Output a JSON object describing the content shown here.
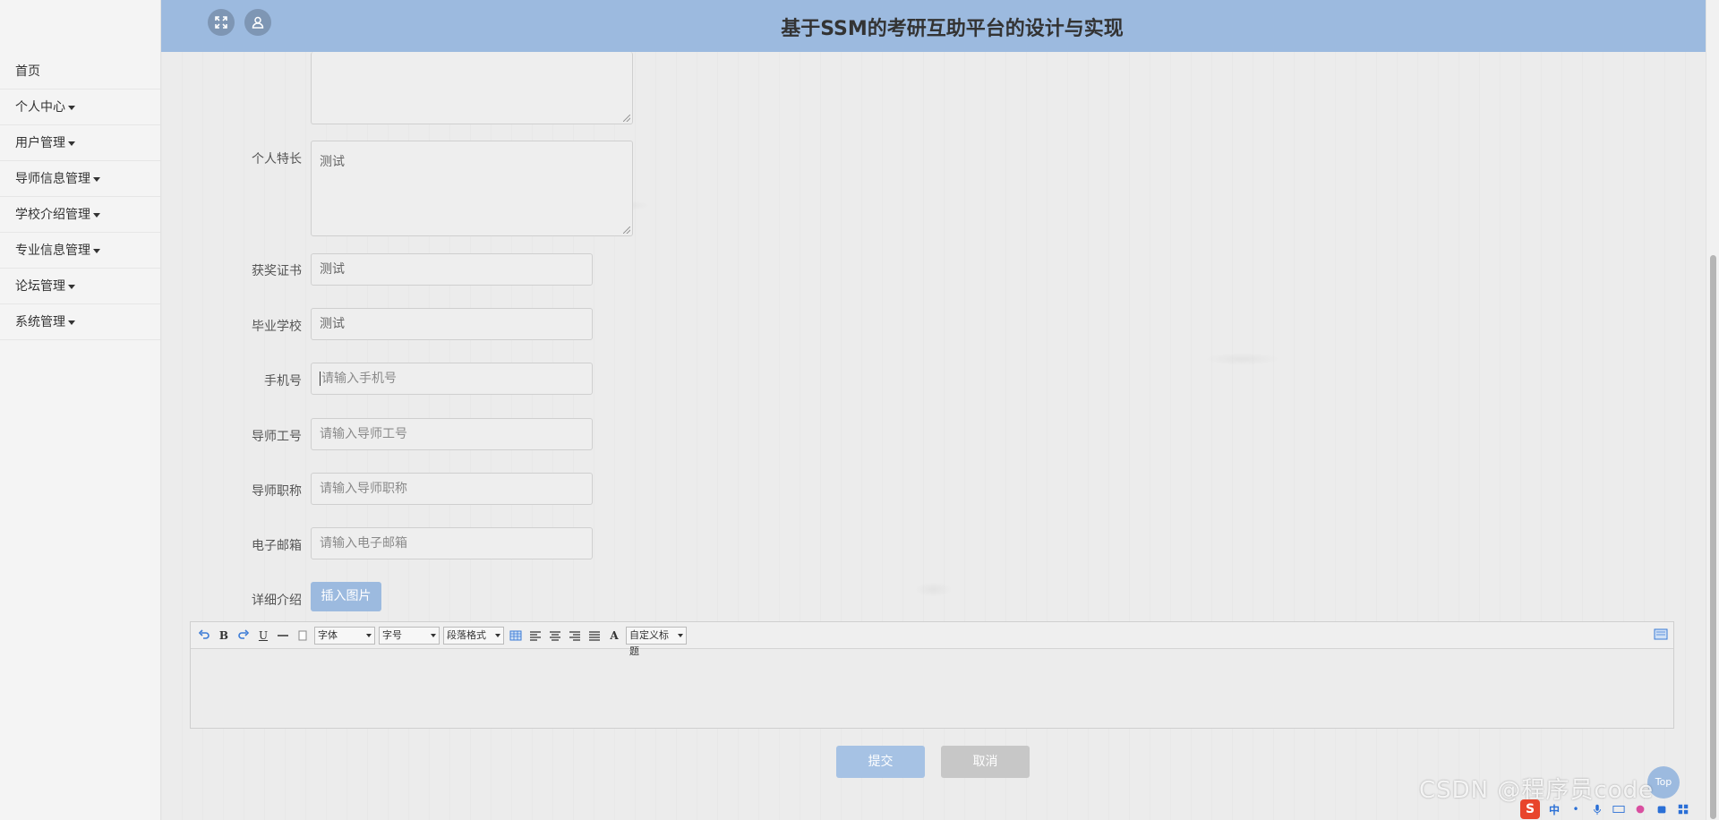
{
  "sidebar": {
    "items": [
      {
        "label": "首页",
        "has_caret": false
      },
      {
        "label": "个人中心",
        "has_caret": true
      },
      {
        "label": "用户管理",
        "has_caret": true
      },
      {
        "label": "导师信息管理",
        "has_caret": true
      },
      {
        "label": "学校介绍管理",
        "has_caret": true
      },
      {
        "label": "专业信息管理",
        "has_caret": true
      },
      {
        "label": "论坛管理",
        "has_caret": true
      },
      {
        "label": "系统管理",
        "has_caret": true
      }
    ]
  },
  "header": {
    "title": "基于SSM的考研互助平台的设计与实现",
    "icons": [
      "fullscreen-icon",
      "user-icon"
    ]
  },
  "form": {
    "fields": {
      "personal_specialty": {
        "label": "个人特长",
        "value": "测试"
      },
      "award_certificate": {
        "label": "获奖证书",
        "value": "测试"
      },
      "graduate_school": {
        "label": "毕业学校",
        "value": "测试"
      },
      "phone": {
        "label": "手机号",
        "placeholder": "请输入手机号"
      },
      "tutor_id": {
        "label": "导师工号",
        "placeholder": "请输入导师工号"
      },
      "tutor_title": {
        "label": "导师职称",
        "placeholder": "请输入导师职称"
      },
      "email": {
        "label": "电子邮箱",
        "placeholder": "请输入电子邮箱"
      },
      "details": {
        "label": "详细介绍"
      }
    },
    "insert_image_label": "插入图片"
  },
  "editor": {
    "toolbar": {
      "font_select": "字体",
      "size_select": "字号",
      "paragraph_select": "段落格式",
      "custom_title_select": "自定义标题",
      "font_color_glyph": "A"
    }
  },
  "actions": {
    "submit_label": "提交",
    "cancel_label": "取消"
  },
  "misc": {
    "top_button": "Top",
    "watermark": "CSDN @程序员code",
    "tray_ime": "中"
  },
  "colors": {
    "header_bg": "#9cbadf",
    "submit_bg": "#a6c2e4",
    "cancel_bg": "#c7c7c7",
    "page_bg": "#ececec"
  }
}
